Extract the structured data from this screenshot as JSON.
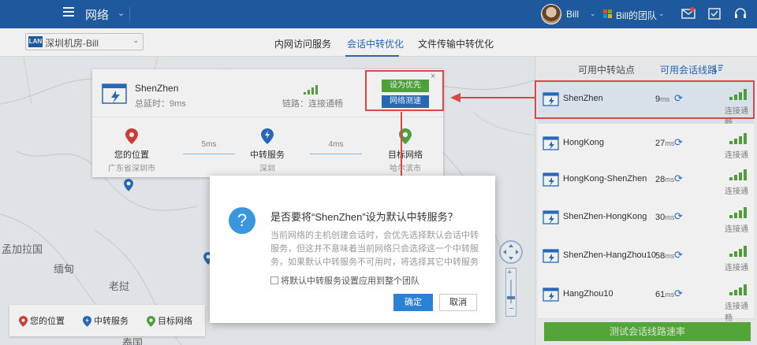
{
  "header": {
    "title": "网络",
    "user_name": "Bill",
    "team_name": "Bill的团队"
  },
  "subbar": {
    "room_badge": "LAN",
    "room_name": "深圳机房-Bill",
    "tabs": [
      "内网访问服务",
      "会话中转优化",
      "文件传输中转优化"
    ],
    "active_tab": 1
  },
  "map": {
    "labels": [
      "孟加拉国",
      "缅甸",
      "老挝",
      "泰国"
    ]
  },
  "card": {
    "server_name": "ShenZhen",
    "latency": "总延时：9ms",
    "status": "链路：连接通畅",
    "prefer_button": "设为优先",
    "speed_button": "网络测速",
    "close": "×",
    "nodes": [
      {
        "label": "您的位置",
        "sub": "广东省深圳市"
      },
      {
        "label": "中转服务",
        "sub": "深圳"
      },
      {
        "label": "目标网络",
        "sub": "哈尔滨市"
      }
    ],
    "links": [
      "5ms",
      "4ms"
    ]
  },
  "legend": {
    "items": [
      "您的位置",
      "中转服务",
      "目标网络"
    ]
  },
  "sidebar": {
    "head_left": "可用中转站点",
    "head_right": "可用会话线路",
    "relays": [
      {
        "name": "ShenZhen",
        "ms": "9",
        "status": "连接通畅"
      },
      {
        "name": "HongKong",
        "ms": "27",
        "status": "连接通畅"
      },
      {
        "name": "HongKong-ShenZhen",
        "ms": "28",
        "status": "连接通畅"
      },
      {
        "name": "ShenZhen-HongKong",
        "ms": "30",
        "status": "连接通畅"
      },
      {
        "name": "ShenZhen-HangZhou10",
        "ms": "58",
        "status": "连接通畅"
      },
      {
        "name": "HangZhou10",
        "ms": "61",
        "status": "连接通畅"
      }
    ],
    "unit": "ms",
    "test_button": "测试会话线路速率"
  },
  "dialog": {
    "title": "是否要将“ShenZhen”设为默认中转服务？",
    "body": "当前网络的主机创建会话时，会优先选择默认会话中转服务，但这并不意味着当前网络只会选择这一个中转服务，如果默认中转服务不可用时，将选择其它中转服务",
    "checkbox_label": "将默认中转服务设置应用到整个团队",
    "ok": "确定",
    "cancel": "取消"
  },
  "colors": {
    "brand": "#1f5fa6",
    "accent": "#2a6fc2",
    "green": "#53a840",
    "highlight": "#e84c4c"
  }
}
